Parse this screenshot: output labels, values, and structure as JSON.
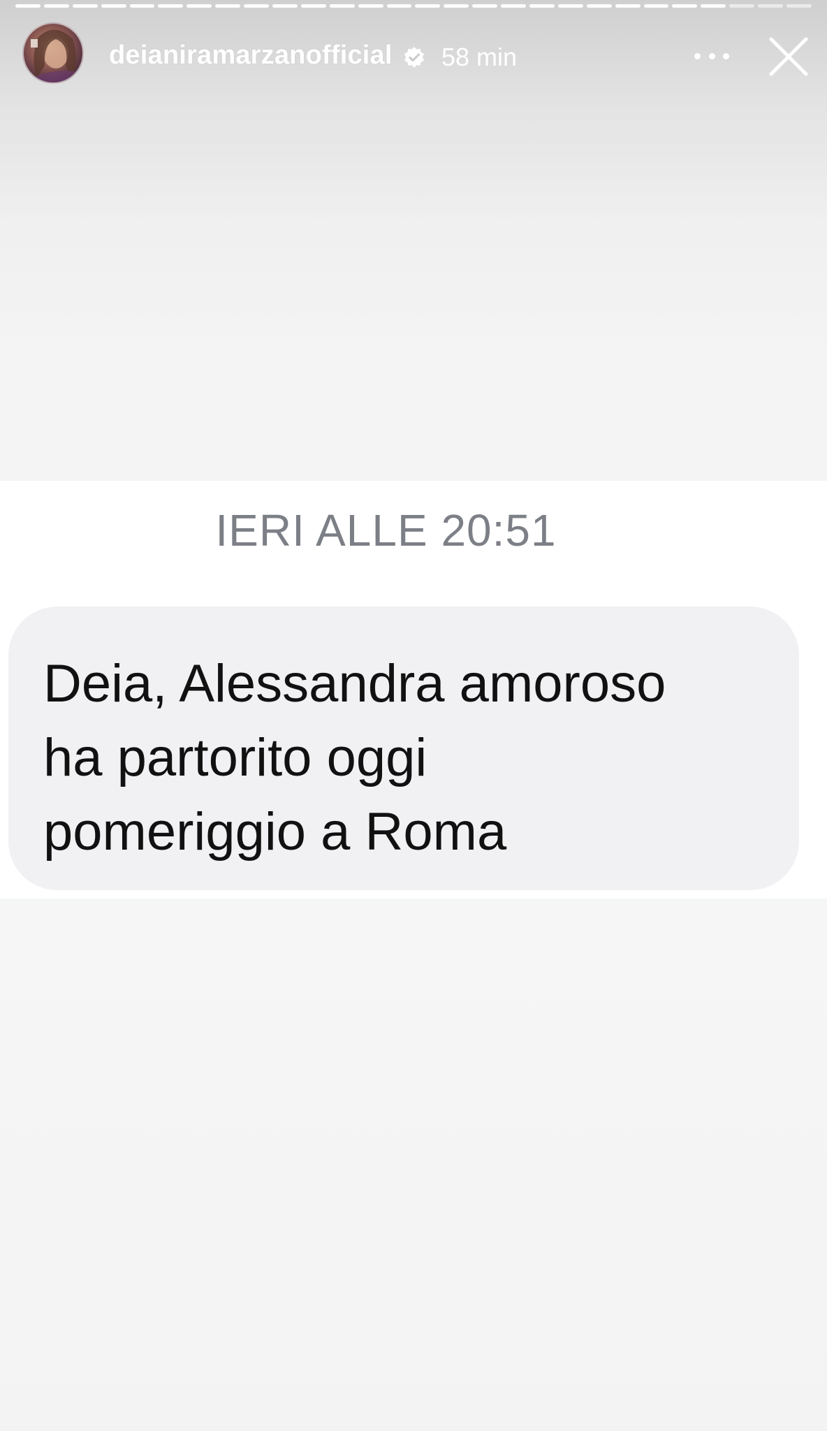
{
  "story": {
    "username": "deianiramarzanofficial",
    "time_ago": "58 min",
    "verified": true,
    "progress_segments": 28,
    "progress_segments_complete": 25
  },
  "header_icons": {
    "verified": "verified-badge-icon",
    "more": "more-options-icon",
    "close": "close-icon"
  },
  "message": {
    "timestamp": "IERI ALLE 20:51",
    "text": "Deia, Alessandra amoroso\nha partorito oggi\npomeriggio a Roma"
  },
  "colors": {
    "bubble": "#f1f1f4",
    "timestamp": "#7c7f86",
    "text": "#111111",
    "background": "#f4f5f5"
  }
}
